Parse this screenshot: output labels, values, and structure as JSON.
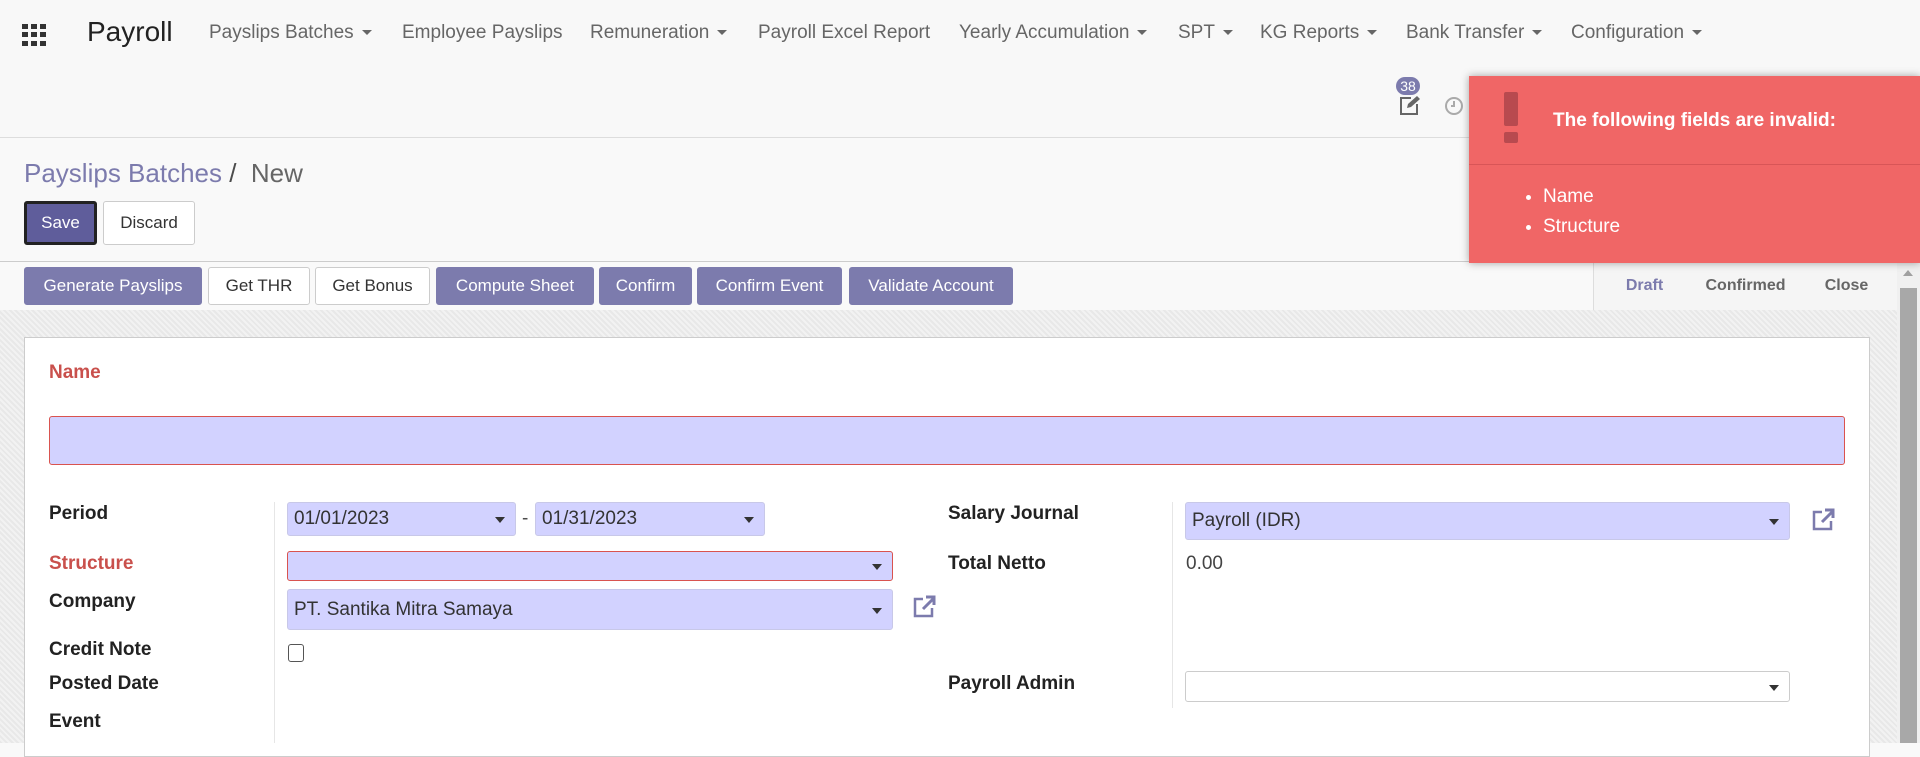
{
  "navbar": {
    "app_title": "Payroll",
    "menus": [
      {
        "label": "Payslips Batches",
        "dropdown": true
      },
      {
        "label": "Employee Payslips",
        "dropdown": false
      },
      {
        "label": "Remuneration",
        "dropdown": true
      },
      {
        "label": "Payroll Excel Report",
        "dropdown": false
      },
      {
        "label": "Yearly Accumulation",
        "dropdown": true
      },
      {
        "label": "SPT",
        "dropdown": true
      },
      {
        "label": "KG Reports",
        "dropdown": true
      },
      {
        "label": "Bank Transfer",
        "dropdown": true
      },
      {
        "label": "Configuration",
        "dropdown": true
      }
    ],
    "activity_badge": "38"
  },
  "breadcrumb": {
    "parent": "Payslips Batches",
    "separator": "/",
    "current": "New"
  },
  "control": {
    "save": "Save",
    "discard": "Discard"
  },
  "actions": [
    "Generate Payslips",
    "Get THR",
    "Get Bonus",
    "Compute Sheet",
    "Confirm",
    "Confirm Event",
    "Validate Account"
  ],
  "statusbar": [
    "Draft",
    "Confirmed",
    "Close"
  ],
  "statusbar_active": "Draft",
  "toast": {
    "title": "The following fields are invalid:",
    "fields": [
      "Name",
      "Structure"
    ]
  },
  "form": {
    "name_label": "Name",
    "name_value": "",
    "period_label": "Period",
    "period_from": "01/01/2023",
    "period_sep": "-",
    "period_to": "01/31/2023",
    "structure_label": "Structure",
    "structure_value": "",
    "company_label": "Company",
    "company_value": "PT. Santika Mitra Samaya",
    "credit_note_label": "Credit Note",
    "credit_note_checked": false,
    "posted_date_label": "Posted Date",
    "event_label": "Event",
    "salary_journal_label": "Salary Journal",
    "salary_journal_value": "Payroll (IDR)",
    "total_netto_label": "Total Netto",
    "total_netto_value": "0.00",
    "payroll_admin_label": "Payroll Admin",
    "payroll_admin_value": ""
  },
  "colors": {
    "primary": "#7c7bad",
    "input_bg": "#d2d2ff",
    "required": "#c9504c",
    "toast": "#f06666"
  }
}
